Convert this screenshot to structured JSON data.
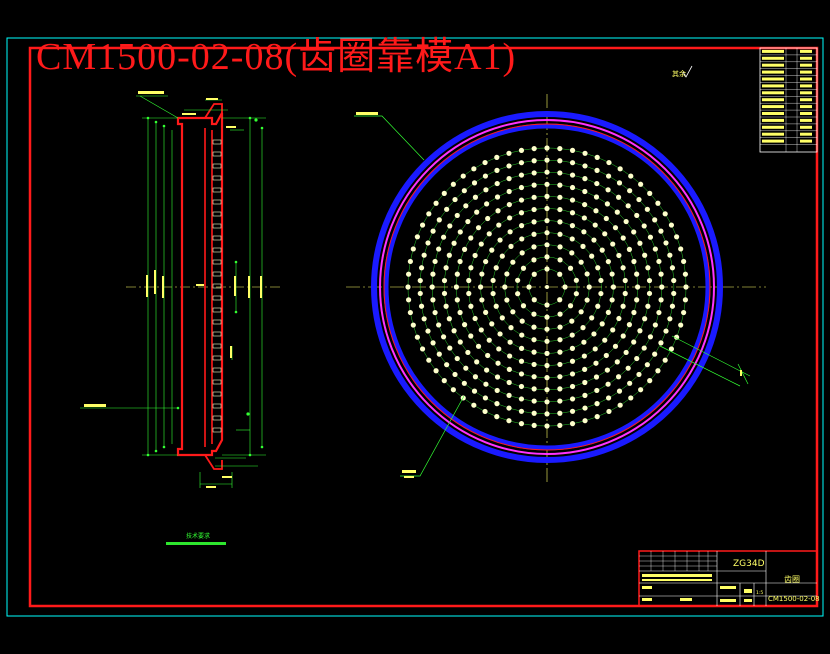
{
  "drawing": {
    "title": "CM1500-02-08(齿圈靠模A1)",
    "drawing_no": "CM1500-02-08",
    "material": "ZG34D",
    "part_name": "齿圈",
    "scale": "1:5",
    "tech_requirements_title": "技术要求",
    "roughness_mark": "其余"
  },
  "colors": {
    "background": "#000000",
    "frame_outer": "#00ffff",
    "frame_inner": "#ff1a1a",
    "part_outline": "#ff1a1a",
    "blue_ring": "#1a1aff",
    "magenta_ring": "#ff33ff",
    "holes": "#ffffcc",
    "dimensions": "#33ff33",
    "centerline": "#ffff66"
  },
  "pattern": {
    "ring_count": 11,
    "hole_counts": [
      8,
      14,
      20,
      26,
      32,
      38,
      44,
      50,
      56,
      62,
      68
    ]
  }
}
